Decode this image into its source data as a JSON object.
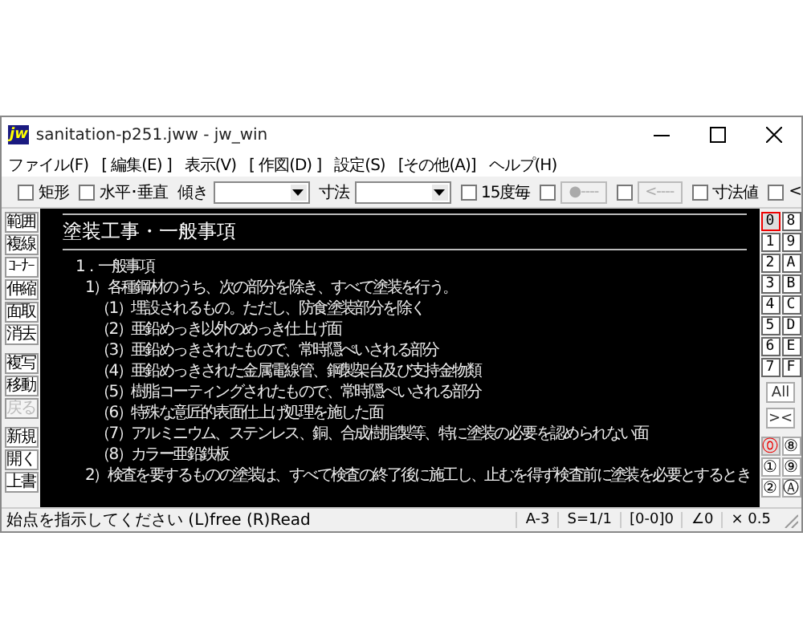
{
  "window": {
    "app_icon": "jw",
    "title": "sanitation-p251.jww - jw_win"
  },
  "menu": [
    "ファイル(F)",
    "[ 編集(E) ]",
    "表示(V)",
    "[ 作図(D) ]",
    "設定(S)",
    "[その他(A)]",
    "ヘルプ(H)"
  ],
  "toolbar": [
    {
      "kind": "checkbox",
      "label": "矩形",
      "checked": false
    },
    {
      "kind": "checkbox",
      "label": "水平･垂直",
      "checked": false
    },
    {
      "kind": "combo",
      "label": "傾き"
    },
    {
      "kind": "combo",
      "label": "寸法"
    },
    {
      "kind": "checkbox",
      "label": "15度毎",
      "checked": false
    },
    {
      "kind": "checkbutton",
      "label": "●----",
      "checked": false
    },
    {
      "kind": "checkbutton",
      "label": "<----",
      "checked": false
    },
    {
      "kind": "checkbox",
      "label": "寸法値",
      "checked": false
    },
    {
      "kind": "checkbox",
      "label": "<",
      "checked": false
    }
  ],
  "tool_groups": [
    [
      {
        "label": "範囲",
        "disabled": false
      },
      {
        "label": "複線",
        "disabled": false
      },
      {
        "label": "ｺｰﾅｰ",
        "disabled": false
      },
      {
        "label": "伸縮",
        "disabled": false
      },
      {
        "label": "面取",
        "disabled": false
      },
      {
        "label": "消去",
        "disabled": false
      }
    ],
    [
      {
        "label": "複写",
        "disabled": false
      },
      {
        "label": "移動",
        "disabled": false
      },
      {
        "label": "戻る",
        "disabled": true
      }
    ],
    [
      {
        "label": "新規",
        "disabled": false
      },
      {
        "label": "開く",
        "disabled": false
      },
      {
        "label": "上書",
        "disabled": false
      }
    ]
  ],
  "canvas": {
    "heading": "塗装工事・一般事項",
    "lines": [
      {
        "text": "1．一般事項",
        "children": [
          {
            "text": "1）各種鋼材のうち、次の部分を除き、すべて塗装を行う。",
            "children": [
              {
                "text": "（1）埋設されるもの。ただし、防食塗装部分を除く"
              },
              {
                "text": "（2）亜鉛めっき以外のめっき仕上げ面"
              },
              {
                "text": "（3）亜鉛めっきされたもので、常時隠ぺいされる部分"
              },
              {
                "text": "（4）亜鉛めっきされた金属電線管、鋼製架台及び支持金物類"
              },
              {
                "text": "（5）樹脂コーティングされたもので、常時隠ぺいされる部分"
              },
              {
                "text": "（6）特殊な意匠的表面仕上げ処理を施した面"
              },
              {
                "text": "（7）アルミニウム、ステンレス、銅、合成樹脂製等、特に塗装の必要を認められない面"
              },
              {
                "text": "（8）カラー亜鉛鉄板"
              }
            ]
          },
          {
            "text": "2）検査を要するものの塗装は、すべて検査の終了後に施工し、止むを得ず検査前に塗装を必要とするとき"
          }
        ]
      }
    ]
  },
  "layers": [
    {
      "label": "0",
      "selected": true
    },
    {
      "label": "8",
      "selected": false
    },
    {
      "label": "1",
      "selected": false
    },
    {
      "label": "9",
      "selected": false
    },
    {
      "label": "2",
      "selected": false
    },
    {
      "label": "A",
      "selected": false
    },
    {
      "label": "3",
      "selected": false
    },
    {
      "label": "B",
      "selected": false
    },
    {
      "label": "4",
      "selected": false
    },
    {
      "label": "C",
      "selected": false
    },
    {
      "label": "5",
      "selected": false
    },
    {
      "label": "D",
      "selected": false
    },
    {
      "label": "6",
      "selected": false
    },
    {
      "label": "E",
      "selected": false
    },
    {
      "label": "7",
      "selected": false
    },
    {
      "label": "F",
      "selected": false
    }
  ],
  "layer_all": "All",
  "layer_toggle": "><",
  "layer_groups": [
    {
      "label": "⓪",
      "selected": true
    },
    {
      "label": "⑧",
      "selected": false
    },
    {
      "label": "①",
      "selected": false
    },
    {
      "label": "⑨",
      "selected": false
    },
    {
      "label": "②",
      "selected": false
    },
    {
      "label": "Ⓐ",
      "selected": false
    }
  ],
  "status_bar": {
    "message": "始点を指示してください (L)free (R)Read",
    "fields": [
      "A-3",
      "S=1/1",
      "[0-0]0",
      "∠0",
      "× 0.5"
    ]
  }
}
